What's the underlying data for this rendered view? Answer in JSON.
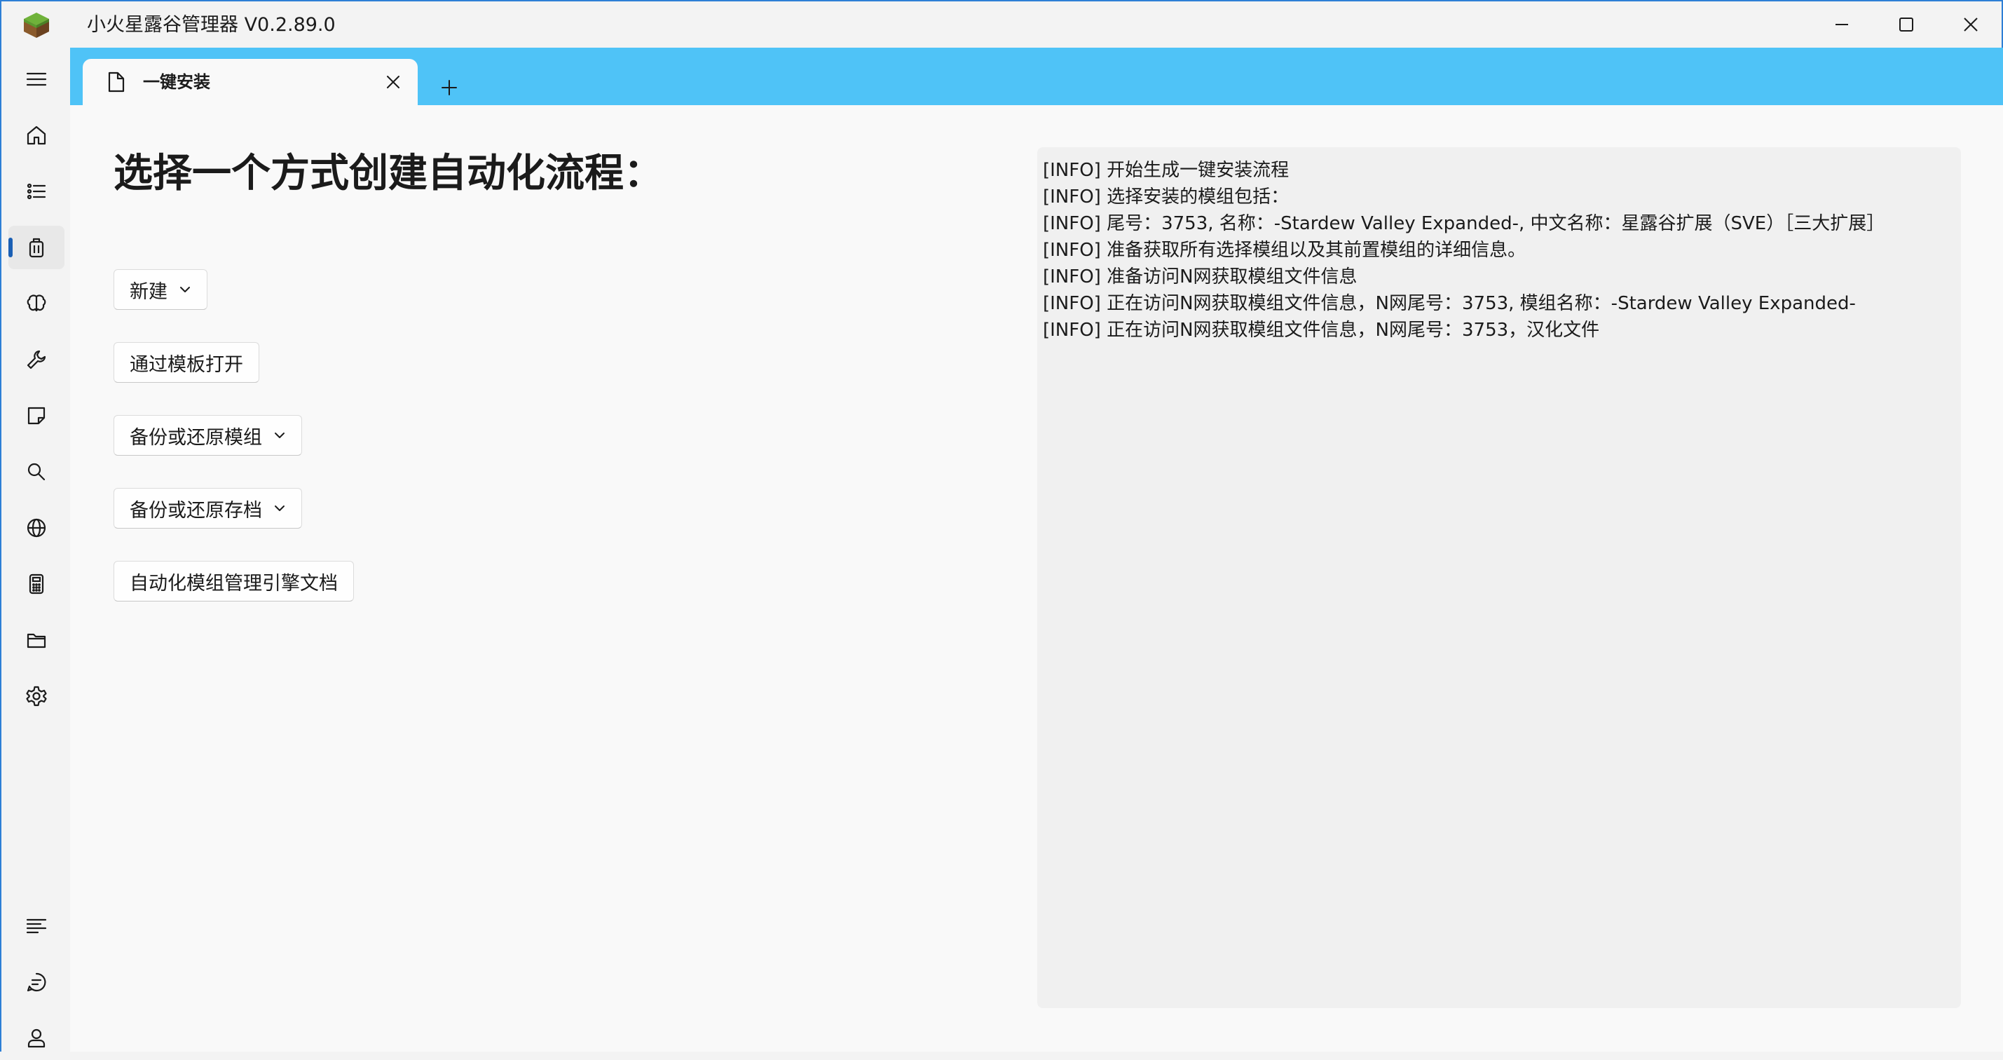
{
  "app": {
    "title": "小火星露谷管理器 V0.2.89.0"
  },
  "window_controls": {
    "minimize_icon": "minimize-icon",
    "maximize_icon": "maximize-icon",
    "close_icon": "close-icon"
  },
  "nav": {
    "items": [
      {
        "id": "menu",
        "icon": "hamburger-menu-icon"
      },
      {
        "id": "home",
        "icon": "home-icon"
      },
      {
        "id": "mod-list",
        "icon": "list-icon"
      },
      {
        "id": "one-click-install",
        "icon": "package-icon",
        "selected": true
      },
      {
        "id": "brain",
        "icon": "brain-icon"
      },
      {
        "id": "tools",
        "icon": "wrench-icon"
      },
      {
        "id": "notes",
        "icon": "sticky-note-icon"
      },
      {
        "id": "search",
        "icon": "search-icon"
      },
      {
        "id": "web",
        "icon": "globe-icon"
      },
      {
        "id": "calculator",
        "icon": "calculator-icon"
      },
      {
        "id": "folder",
        "icon": "folder-icon"
      },
      {
        "id": "settings",
        "icon": "gear-icon"
      }
    ],
    "bottom_items": [
      {
        "id": "log",
        "icon": "lines-icon"
      },
      {
        "id": "chat",
        "icon": "chat-bubble-icon"
      },
      {
        "id": "account",
        "icon": "user-icon"
      }
    ]
  },
  "tabs": [
    {
      "label": "一键安装",
      "icon": "document-icon",
      "active": true
    }
  ],
  "main": {
    "title": "选择一个方式创建自动化流程：",
    "buttons": [
      {
        "label": "新建",
        "has_dropdown": true
      },
      {
        "label": "通过模板打开",
        "has_dropdown": false
      },
      {
        "label": "备份或还原模组",
        "has_dropdown": true
      },
      {
        "label": "备份或还原存档",
        "has_dropdown": true
      },
      {
        "label": "自动化模组管理引擎文档",
        "has_dropdown": false
      }
    ]
  },
  "log": {
    "lines": [
      "[INFO] 开始生成一键安装流程",
      "[INFO] 选择安装的模组包括：",
      "[INFO] 尾号：3753, 名称：-Stardew Valley Expanded-, 中文名称：星露谷扩展（SVE）［三大扩展］",
      "[INFO] 准备获取所有选择模组以及其前置模组的详细信息。",
      "[INFO] 准备访问N网获取模组文件信息",
      "[INFO] 正在访问N网获取模组文件信息，N网尾号：3753, 模组名称：-Stardew Valley Expanded-",
      "[INFO] 正在访问N网获取模组文件信息，N网尾号：3753，汉化文件"
    ]
  },
  "colors": {
    "tabstrip": "#4fc3f7",
    "selection_indicator": "#1a5fb4",
    "window_border": "#2d7fd6"
  }
}
